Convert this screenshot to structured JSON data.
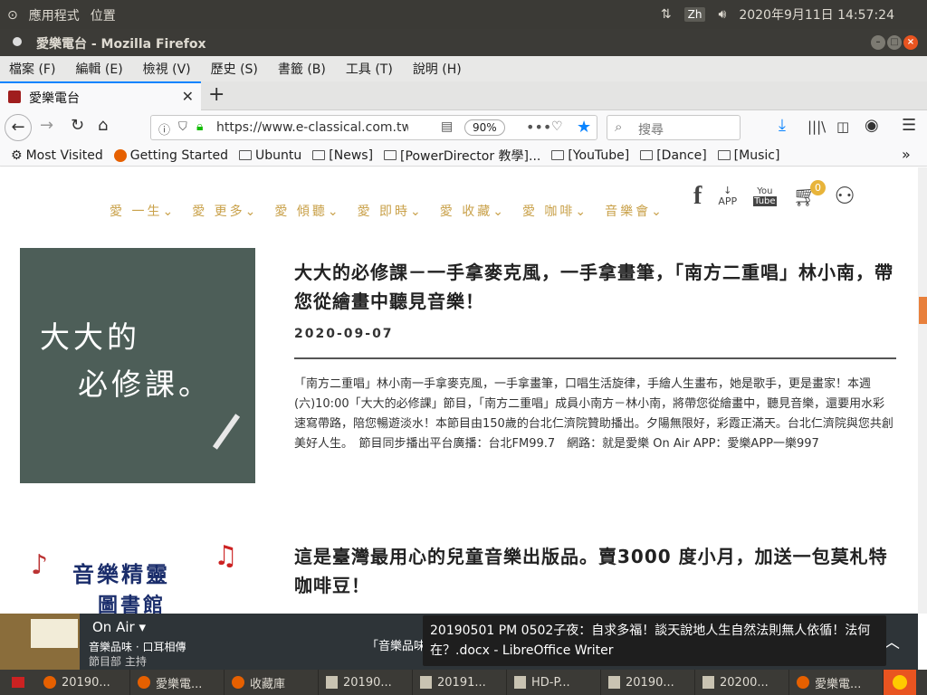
{
  "system_panel": {
    "apps": "應用程式",
    "places": "位置",
    "lang": "Zh",
    "datetime": "2020年9月11日 14:57:24"
  },
  "window": {
    "title": "愛樂電台 - Mozilla Firefox"
  },
  "menubar": {
    "items": [
      "檔案 (F)",
      "編輯 (E)",
      "檢視 (V)",
      "歷史 (S)",
      "書籤 (B)",
      "工具 (T)",
      "說明 (H)"
    ]
  },
  "tab": {
    "title": "愛樂電台"
  },
  "nav": {
    "url": "https://www.e-classical.com.tw",
    "zoom": "90%",
    "search_placeholder": "搜尋"
  },
  "bookmarks": [
    "Most Visited",
    "Getting Started",
    "Ubuntu",
    "[News]",
    "[PowerDirector 教學]...",
    "[YouTube]",
    "[Dance]",
    "[Music]"
  ],
  "site": {
    "nav": [
      "愛 一生",
      "愛 更多",
      "愛 傾聽",
      "愛 即時",
      "愛 收藏",
      "愛 咖啡",
      "音樂會"
    ],
    "icons": {
      "app": "APP",
      "you": "You",
      "tube": "Tube"
    },
    "cart_count": "0"
  },
  "articles": [
    {
      "image_text_1": "大大的",
      "image_text_2": "必修課。",
      "title": "大大的必修課－一手拿麥克風，一手拿畫筆，「南方二重唱」林小南，帶您從繪畫中聽見音樂！",
      "date": "2020-09-07",
      "body": "「南方二重唱」林小南一手拿麥克風，一手拿畫筆，口唱生活旋律，手繪人生畫布，她是歌手，更是畫家！本週(六)10:00「大大的必修課」節目，「南方二重唱」成員小南方－林小南，將帶您從繪畫中，聽見音樂，還要用水彩速寫帶路，陪您暢遊淡水！本節目由150歲的台北仁濟院贊助播出。夕陽無限好，彩霞正滿天。台北仁濟院與您共創美好人生。　節目同步播出平台廣播：台北FM99.7　網路：就是愛樂 On Air APP：愛樂APP一樂997"
    },
    {
      "image_text_1": "音樂精靈",
      "image_text_2": "圖書館",
      "title": "這是臺灣最用心的兒童音樂出版品。賣3000 度小月，加送一包莫札特咖啡豆！"
    }
  ],
  "player": {
    "on_air": "On Air ▾",
    "program": "音樂品味 · 口耳相傳",
    "host": "節目部 主持",
    "ticker": "「音樂品味"
  },
  "tooltip": "20190501 PM 0502子夜：自求多福！談天說地人生自然法則無人依循！法何在？.docx - LibreOffice Writer",
  "taskbar": [
    "20190...",
    "愛樂電...",
    "收藏庫",
    "20190...",
    "20191...",
    "HD-P...",
    "20190...",
    "20200...",
    "愛樂電..."
  ]
}
